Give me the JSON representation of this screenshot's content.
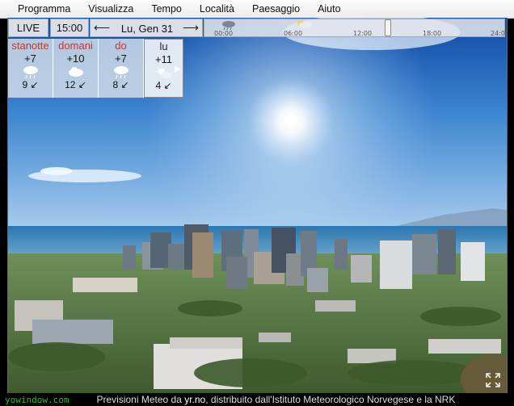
{
  "menu": [
    "Programma",
    "Visualizza",
    "Tempo",
    "Località",
    "Paesaggio",
    "Aiuto"
  ],
  "topbar": {
    "live_label": "LIVE",
    "time_label": "15:00",
    "date_label": "Lu, Gen 31",
    "left_arrow": "⟵",
    "right_arrow": "⟶"
  },
  "timeline": {
    "ticks": [
      "00:00",
      "06:00",
      "12:00",
      "18:00",
      "24:00"
    ],
    "icons": [
      "rain-cloud-icon",
      "partly-cloudy-icon"
    ]
  },
  "forecast": [
    {
      "name": "stanotte",
      "temp": "+7",
      "icon": "rain-cloud-icon",
      "wind": "9 ↙"
    },
    {
      "name": "domani",
      "temp": "+10",
      "icon": "cloud-icon",
      "wind": "12 ↙"
    },
    {
      "name": "do",
      "temp": "+7",
      "icon": "rain-cloud-icon",
      "wind": "8 ↙"
    },
    {
      "name": "lu",
      "temp": "+11",
      "icon": "sun-cloud-icon",
      "wind": "4 ↙"
    }
  ],
  "footer": {
    "site": "yowindow.com",
    "text_before": "Previsioni Meteo da ",
    "link": "yr.no",
    "text_after": ", distribuito dall'Istituto Meteorologico Norvegese e la NRK"
  },
  "colors": {
    "accent_day": "#c0392b",
    "footer_site": "#27c03a",
    "sky_top": "#0d4aa6",
    "sky_bottom": "#9fc4e8"
  }
}
